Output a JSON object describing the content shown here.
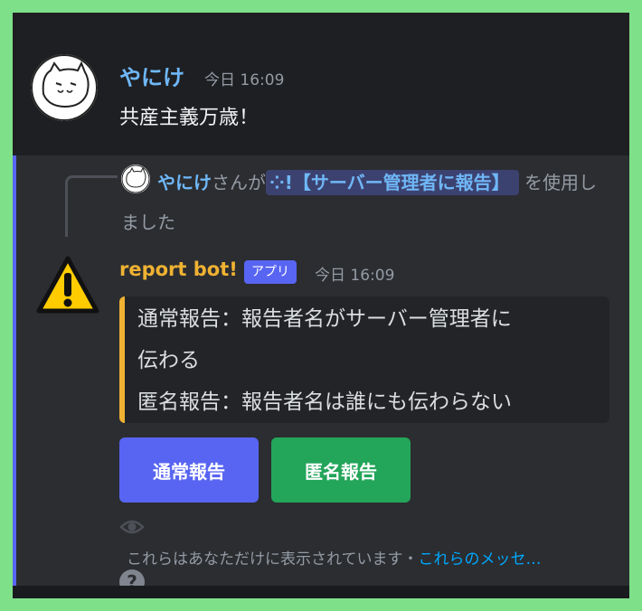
{
  "message1": {
    "author": "やにけ",
    "timestamp": "今日 16:09",
    "text": "共産主義万歳！"
  },
  "message2": {
    "reply": {
      "user": "やにけ",
      "middle": "さんが",
      "command": "!【サーバー管理者に報告】",
      "suffix": "を使用しました"
    },
    "bot_name": "report bot!",
    "app_badge": "アプリ",
    "timestamp": "今日 16:09",
    "embed_lines": [
      "通常報告：報告者名がサーバー管理者に",
      "伝わる",
      "匿名報告：報告者名は誰にも伝わらない"
    ],
    "buttons": {
      "normal": "通常報告",
      "anonymous": "匿名報告"
    },
    "ephemeral_note": "これらはあなただけに表示されています・",
    "ephemeral_link": "これらのメッセ…"
  },
  "colors": {
    "frame": "#7fe08a",
    "blurple": "#5865f2",
    "green": "#23a55a",
    "gold": "#f0b232",
    "link": "#00a8fc"
  }
}
